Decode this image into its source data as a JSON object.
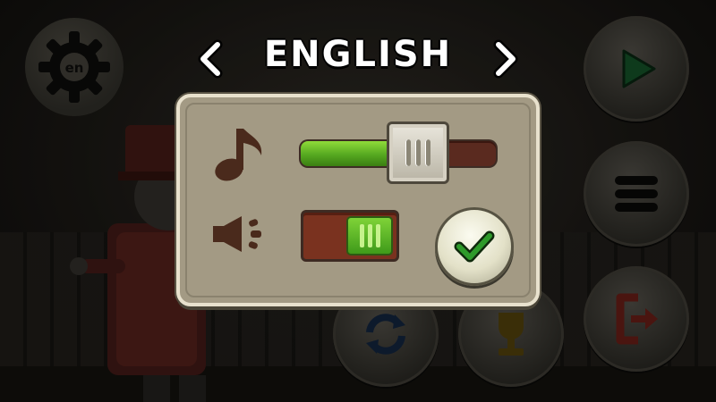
{
  "language": {
    "current": "ENGLISH",
    "badge": "en"
  },
  "settings": {
    "music_volume": 0.6,
    "sound_on": true
  },
  "colors": {
    "panel": "#a39a84",
    "panel_border": "#e8e1cd",
    "icon_brown": "#4a2a1c",
    "slider_green": "#6cc52c",
    "slider_track": "#5a2a1f",
    "check_green": "#2e9a2a"
  },
  "icons": {
    "language": "gear-icon",
    "previous": "chevron-left-icon",
    "next": "chevron-right-icon",
    "music": "music-note-icon",
    "sound": "speaker-icon",
    "confirm": "checkmark-icon",
    "play": "play-icon",
    "menu": "menu-icon",
    "exit": "exit-icon",
    "refresh": "refresh-icon",
    "trophy": "trophy-icon"
  }
}
